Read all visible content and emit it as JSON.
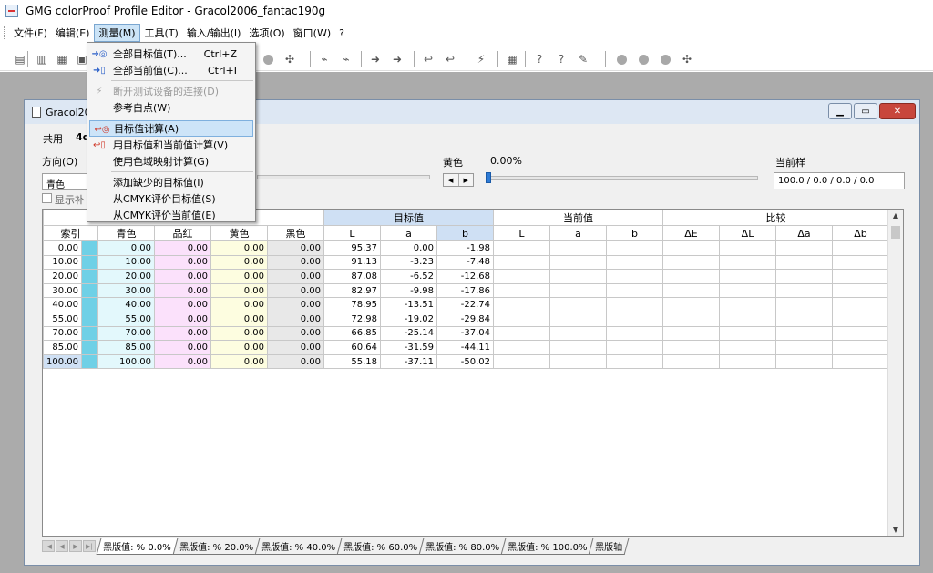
{
  "app": {
    "title": "GMG colorProof Profile Editor - Gracol2006_fantac190g"
  },
  "menubar": [
    {
      "label": "文件(F)"
    },
    {
      "label": "编辑(E)"
    },
    {
      "label": "测量(M)"
    },
    {
      "label": "工具(T)"
    },
    {
      "label": "输入/输出(I)"
    },
    {
      "label": "选项(O)"
    },
    {
      "label": "窗口(W)"
    },
    {
      "label": "?"
    }
  ],
  "dropdown": {
    "items": [
      {
        "label": "全部目标值(T)...",
        "shortcut": "Ctrl+Z",
        "icon": "arrow-target-icon",
        "disabled": false
      },
      {
        "label": "全部当前值(C)...",
        "shortcut": "Ctrl+I",
        "icon": "arrow-current-icon",
        "disabled": false
      },
      {
        "sep": true
      },
      {
        "label": "断开测试设备的连接(D)",
        "shortcut": "",
        "icon": "disconnect-icon",
        "disabled": true
      },
      {
        "label": "参考白点(W)",
        "shortcut": "",
        "icon": "",
        "disabled": false
      },
      {
        "sep": true
      },
      {
        "label": "目标值计算(A)",
        "shortcut": "",
        "icon": "calc-target-icon",
        "disabled": false,
        "highlight": true
      },
      {
        "label": "用目标值和当前值计算(V)",
        "shortcut": "",
        "icon": "calc-both-icon",
        "disabled": false
      },
      {
        "label": "使用色域映射计算(G)",
        "shortcut": "",
        "icon": "",
        "disabled": false
      },
      {
        "sep": true
      },
      {
        "label": "添加缺少的目标值(I)",
        "shortcut": "",
        "icon": "",
        "disabled": false
      },
      {
        "label": "从CMYK评价目标值(S)",
        "shortcut": "",
        "icon": "",
        "disabled": false
      },
      {
        "label": "从CMYK评价当前值(E)",
        "shortcut": "",
        "icon": "",
        "disabled": false
      }
    ]
  },
  "child": {
    "title": "Gracol20",
    "tab_common": "共用",
    "tab_second": "4d",
    "direction_label": "方向(O)",
    "direction_value": "青色",
    "show_checkbox": "显示补",
    "yellow_label": "黄色",
    "yellow_value": "0.00%",
    "current_sample_label": "当前样",
    "current_sample_value": "100.0 / 0.0 / 0.0 / 0.0",
    "yellow_slider_fraction": 0.0
  },
  "grid": {
    "groups": {
      "target": "目标值",
      "current": "当前值",
      "compare": "比较"
    },
    "headers": [
      "索引",
      "青色",
      "品红",
      "黄色",
      "黑色",
      "L",
      "a",
      "b",
      "L",
      "a",
      "b",
      "ΔE",
      "ΔL",
      "Δa",
      "Δb"
    ],
    "rows": [
      {
        "idx": "0.00",
        "c": "0.00",
        "m": "0.00",
        "y": "0.00",
        "k": "0.00",
        "L": "95.37",
        "a": "0.00",
        "b": "-1.98"
      },
      {
        "idx": "10.00",
        "c": "10.00",
        "m": "0.00",
        "y": "0.00",
        "k": "0.00",
        "L": "91.13",
        "a": "-3.23",
        "b": "-7.48"
      },
      {
        "idx": "20.00",
        "c": "20.00",
        "m": "0.00",
        "y": "0.00",
        "k": "0.00",
        "L": "87.08",
        "a": "-6.52",
        "b": "-12.68"
      },
      {
        "idx": "30.00",
        "c": "30.00",
        "m": "0.00",
        "y": "0.00",
        "k": "0.00",
        "L": "82.97",
        "a": "-9.98",
        "b": "-17.86"
      },
      {
        "idx": "40.00",
        "c": "40.00",
        "m": "0.00",
        "y": "0.00",
        "k": "0.00",
        "L": "78.95",
        "a": "-13.51",
        "b": "-22.74"
      },
      {
        "idx": "55.00",
        "c": "55.00",
        "m": "0.00",
        "y": "0.00",
        "k": "0.00",
        "L": "72.98",
        "a": "-19.02",
        "b": "-29.84"
      },
      {
        "idx": "70.00",
        "c": "70.00",
        "m": "0.00",
        "y": "0.00",
        "k": "0.00",
        "L": "66.85",
        "a": "-25.14",
        "b": "-37.04"
      },
      {
        "idx": "85.00",
        "c": "85.00",
        "m": "0.00",
        "y": "0.00",
        "k": "0.00",
        "L": "60.64",
        "a": "-31.59",
        "b": "-44.11"
      },
      {
        "idx": "100.00",
        "c": "100.00",
        "m": "0.00",
        "y": "0.00",
        "k": "0.00",
        "L": "55.18",
        "a": "-37.11",
        "b": "-50.02"
      }
    ]
  },
  "sheets": [
    {
      "label": "黑版值: % 0.0%",
      "active": true
    },
    {
      "label": "黑版值: % 20.0%"
    },
    {
      "label": "黑版值: % 40.0%"
    },
    {
      "label": "黑版值: % 60.0%"
    },
    {
      "label": "黑版值: % 80.0%"
    },
    {
      "label": "黑版值: % 100.0%"
    },
    {
      "label": "黑版轴"
    }
  ],
  "colors": {
    "cyan_swatch": "#6fd0e6",
    "magenta_cell": "#fbe1fb",
    "yellow_cell": "#fdfde0",
    "black_cell": "#e8e8e8",
    "selection": "#cfe0f4"
  }
}
